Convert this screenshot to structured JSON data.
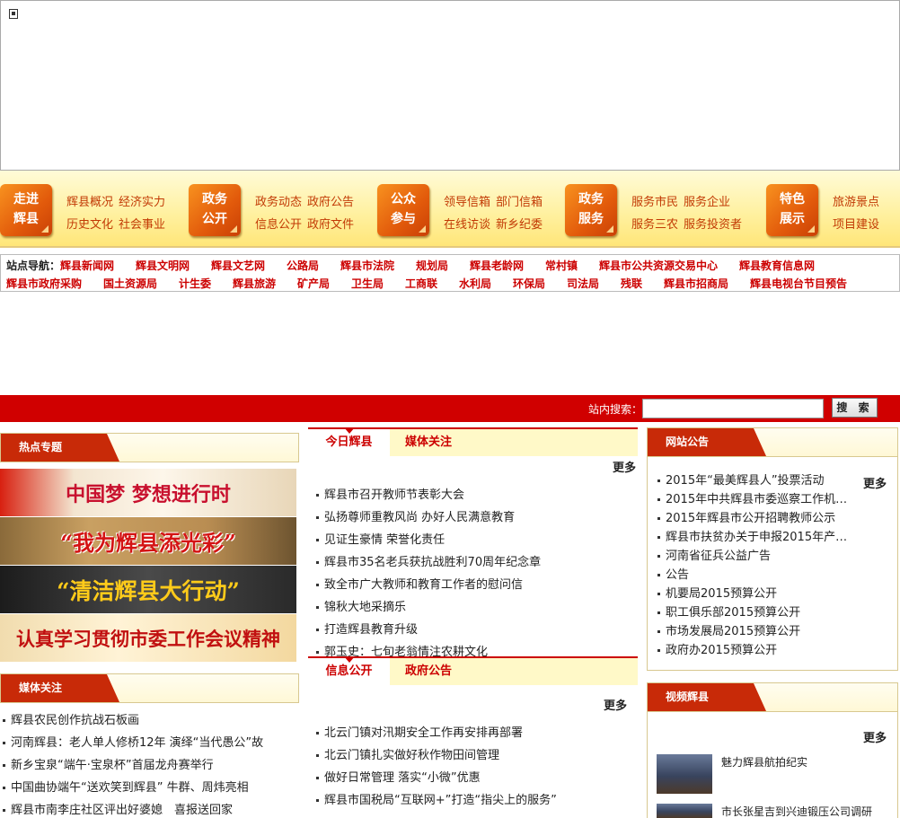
{
  "nav": [
    {
      "label": "走进\n辉县",
      "links": [
        "辉县概况",
        "经济实力",
        "历史文化",
        "社会事业"
      ]
    },
    {
      "label": "政务\n公开",
      "links": [
        "政务动态",
        "政府公告",
        "信息公开",
        "政府文件"
      ]
    },
    {
      "label": "公众\n参与",
      "links": [
        "领导信箱",
        "部门信箱",
        "在线访谈",
        "新乡纪委"
      ]
    },
    {
      "label": "政务\n服务",
      "links": [
        "服务市民",
        "服务企业",
        "服务三农",
        "服务投资者"
      ]
    },
    {
      "label": "特色\n展示",
      "links": [
        "旅游景点",
        "项目建设"
      ]
    }
  ],
  "sitenav": {
    "prefix": "站点导航：",
    "row1": [
      "辉县新闻网",
      "辉县文明网",
      "辉县文艺网",
      "公路局",
      "辉县市法院",
      "规划局",
      "辉县老龄网",
      "常村镇",
      "辉县市公共资源交易中心",
      "辉县教育信息网"
    ],
    "row2": [
      "辉县市政府采购",
      "国土资源局",
      "计生委",
      "辉县旅游",
      "矿产局",
      "卫生局",
      "工商联",
      "水利局",
      "环保局",
      "司法局",
      "残联",
      "辉县市招商局",
      "辉县电视台节目预告"
    ]
  },
  "search": {
    "label": "站内搜索：",
    "button": "搜 索"
  },
  "hot": {
    "title": "热点专题",
    "banners": [
      "中国梦 梦想进行时",
      "“我为辉县添光彩”",
      "“清洁辉县大行动”",
      "认真学习贯彻市委工作会议精神"
    ]
  },
  "media_left": {
    "title": "媒体关注",
    "items": [
      "辉县农民创作抗战石板画",
      "河南辉县：老人单人修桥12年 演绎“当代愚公”故",
      "新乡宝泉“端午·宝泉杯”首届龙舟赛举行",
      "中国曲协端午“送欢笑到辉县” 牛群、周炜亮相",
      "辉县市南李庄社区评出好婆媳　喜报送回家"
    ]
  },
  "today": {
    "tab1": "今日辉县",
    "tab2": "媒体关注",
    "more": "更多",
    "items": [
      "辉县市召开教师节表彰大会",
      "弘扬尊师重教风尚 办好人民满意教育",
      "见证生豪情 荣誉化责任",
      "辉县市35名老兵获抗战胜利70周年纪念章",
      "致全市广大教师和教育工作者的慰问信",
      "锦秋大地采摘乐",
      "打造辉县教育升级",
      "郭玉史：七旬老翁情注农耕文化"
    ]
  },
  "info": {
    "tab1": "信息公开",
    "tab2": "政府公告",
    "more": "更多",
    "items": [
      "北云门镇对汛期安全工作再安排再部署",
      "北云门镇扎实做好秋作物田间管理",
      "做好日常管理 落实“小微”优惠",
      "辉县市国税局“互联网+”打造“指尖上的服务”"
    ]
  },
  "notice": {
    "title": "网站公告",
    "more": "更多",
    "items": [
      "2015年“最美辉县人”投票活动",
      "2015年中共辉县市委巡察工作机…",
      "2015年辉县市公开招聘教师公示",
      "辉县市扶贫办关于申报2015年产…",
      "河南省征兵公益广告",
      "公告",
      "机要局2015预算公开",
      "职工俱乐部2015预算公开",
      "市场发展局2015预算公开",
      "政府办2015预算公开"
    ]
  },
  "video": {
    "title": "视频辉县",
    "more": "更多",
    "items": [
      "魅力辉县航拍纪实",
      "市长张星吉到兴迪锻压公司调研"
    ]
  },
  "colors": {
    "accent": "#d00000",
    "nav_orange": "#e25a0b",
    "link_red": "#c00000"
  }
}
